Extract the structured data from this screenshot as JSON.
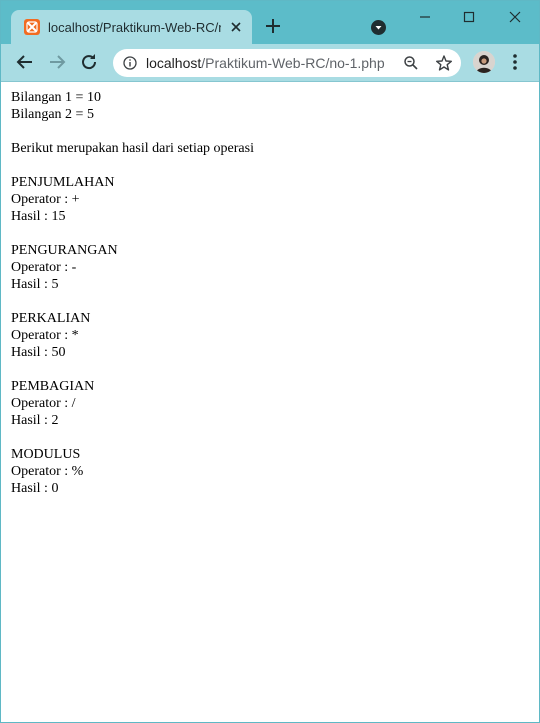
{
  "browser": {
    "tab_title": "localhost/Praktikum-Web-RC/no-1.php",
    "url_host": "localhost",
    "url_path": "/Praktikum-Web-RC/no-1.php",
    "tab_color": "#5cbcc9",
    "toolbar_color": "#a9dce3"
  },
  "page": {
    "bilangan1": "Bilangan 1 = 10",
    "bilangan2": "Bilangan 2 = 5",
    "intro": "Berikut merupakan hasil dari setiap operasi",
    "operations": [
      {
        "name": "PENJUMLAHAN",
        "operator": "Operator : +",
        "result": "Hasil : 15"
      },
      {
        "name": "PENGURANGAN",
        "operator": "Operator : -",
        "result": "Hasil : 5"
      },
      {
        "name": "PERKALIAN",
        "operator": "Operator : *",
        "result": "Hasil : 50"
      },
      {
        "name": "PEMBAGIAN",
        "operator": "Operator : /",
        "result": "Hasil : 2"
      },
      {
        "name": "MODULUS",
        "operator": "Operator : %",
        "result": "Hasil : 0"
      }
    ]
  }
}
